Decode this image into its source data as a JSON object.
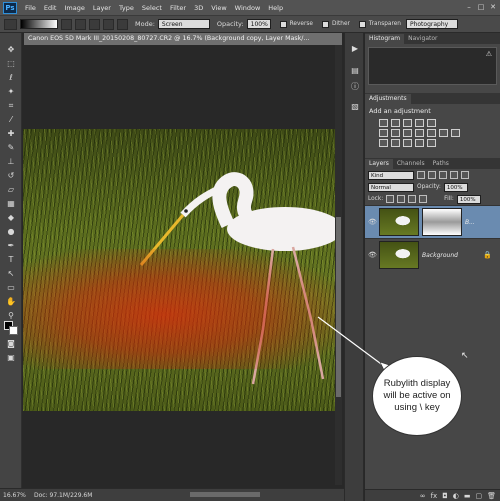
{
  "app": {
    "logo": "Ps"
  },
  "menu": [
    "File",
    "Edit",
    "Image",
    "Layer",
    "Type",
    "Select",
    "Filter",
    "3D",
    "View",
    "Window",
    "Help"
  ],
  "window_controls": [
    "–",
    "□",
    "✕"
  ],
  "options": {
    "mode_label": "Mode:",
    "mode_value": "Screen",
    "opacity_label": "Opacity:",
    "opacity_value": "100%",
    "reverse_label": "Reverse",
    "dither_label": "Dither",
    "transparency_label": "Transparen",
    "workspace_value": "Photography"
  },
  "document": {
    "tab_title": "Canon EOS 5D Mark III_20150208_80727.CR2 @ 16.7% (Background copy, Layer Mask/..."
  },
  "status": {
    "zoom": "16.67%",
    "doc": "Doc: 97.1M/229.6M"
  },
  "panels": {
    "histogram_tab": "Histogram",
    "navigator_tab": "Navigator",
    "adjustments_tab": "Adjustments",
    "adjustments_title": "Add an adjustment",
    "layers_tab": "Layers",
    "channels_tab": "Channels",
    "paths_tab": "Paths",
    "kind_value": "Kind",
    "blend_value": "Normal",
    "opacity_label": "Opacity:",
    "opacity_value": "100%",
    "lock_label": "Lock:",
    "fill_label": "Fill:",
    "fill_value": "100%",
    "layers": [
      {
        "name": "B...",
        "selected": true
      },
      {
        "name": "Background",
        "selected": false
      }
    ]
  },
  "callout": {
    "text": "Rubylith display will be active on using \\ key"
  }
}
